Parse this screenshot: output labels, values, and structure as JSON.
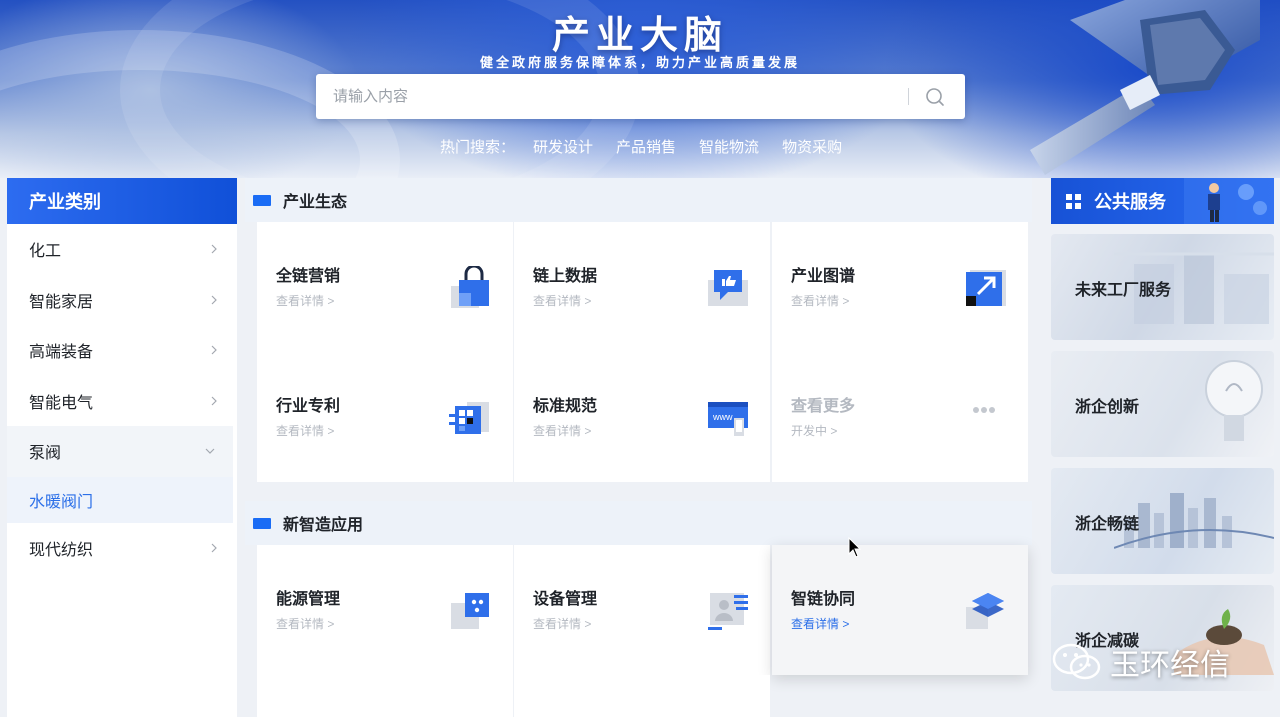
{
  "hero": {
    "title": "产业大脑",
    "subtitle": "健全政府服务保障体系，助力产业高质量发展"
  },
  "search": {
    "placeholder": "请输入内容",
    "value": ""
  },
  "hot_search": {
    "label": "热门搜索：",
    "items": [
      "研发设计",
      "产品销售",
      "智能物流",
      "物资采购"
    ]
  },
  "sidebar": {
    "title": "产业类别",
    "items": [
      {
        "label": "化工"
      },
      {
        "label": "智能家居"
      },
      {
        "label": "高端装备"
      },
      {
        "label": "智能电气"
      },
      {
        "label": "泵阀"
      },
      {
        "label": "水暖阀门"
      },
      {
        "label": "现代纺织"
      }
    ]
  },
  "sections": [
    {
      "title": "产业生态",
      "cards": [
        {
          "title": "全链营销",
          "link": "查看详情 >",
          "icon": "lock-icon"
        },
        {
          "title": "链上数据",
          "link": "查看详情 >",
          "icon": "chat-thumbs-up-icon"
        },
        {
          "title": "产业图谱",
          "link": "查看详情 >",
          "icon": "expand-arrow-icon"
        },
        {
          "title": "行业专利",
          "link": "查看详情 >",
          "icon": "layered-grid-icon"
        },
        {
          "title": "标准规范",
          "link": "查看详情 >",
          "icon": "www-monitor-icon"
        },
        {
          "title": "查看更多",
          "link": "开发中 >",
          "icon": "more-dots-icon"
        }
      ]
    },
    {
      "title": "新智造应用",
      "cards": [
        {
          "title": "能源管理",
          "link": "查看详情 >",
          "icon": "dots-square-icon"
        },
        {
          "title": "设备管理",
          "link": "查看详情 >",
          "icon": "person-card-icon"
        },
        {
          "title": "智链协同",
          "link": "查看详情 >",
          "icon": "stacked-layers-icon"
        }
      ]
    }
  ],
  "public_services": {
    "title": "公共服务",
    "items": [
      {
        "label": "未来工厂服务"
      },
      {
        "label": "浙企创新"
      },
      {
        "label": "浙企畅链"
      },
      {
        "label": "浙企减碳"
      }
    ]
  },
  "watermark": {
    "text": "玉环经信"
  },
  "colors": {
    "accent": "#2b6fe8",
    "header_blue": "#1a5ce0",
    "muted_link": "#b4b9c1"
  }
}
